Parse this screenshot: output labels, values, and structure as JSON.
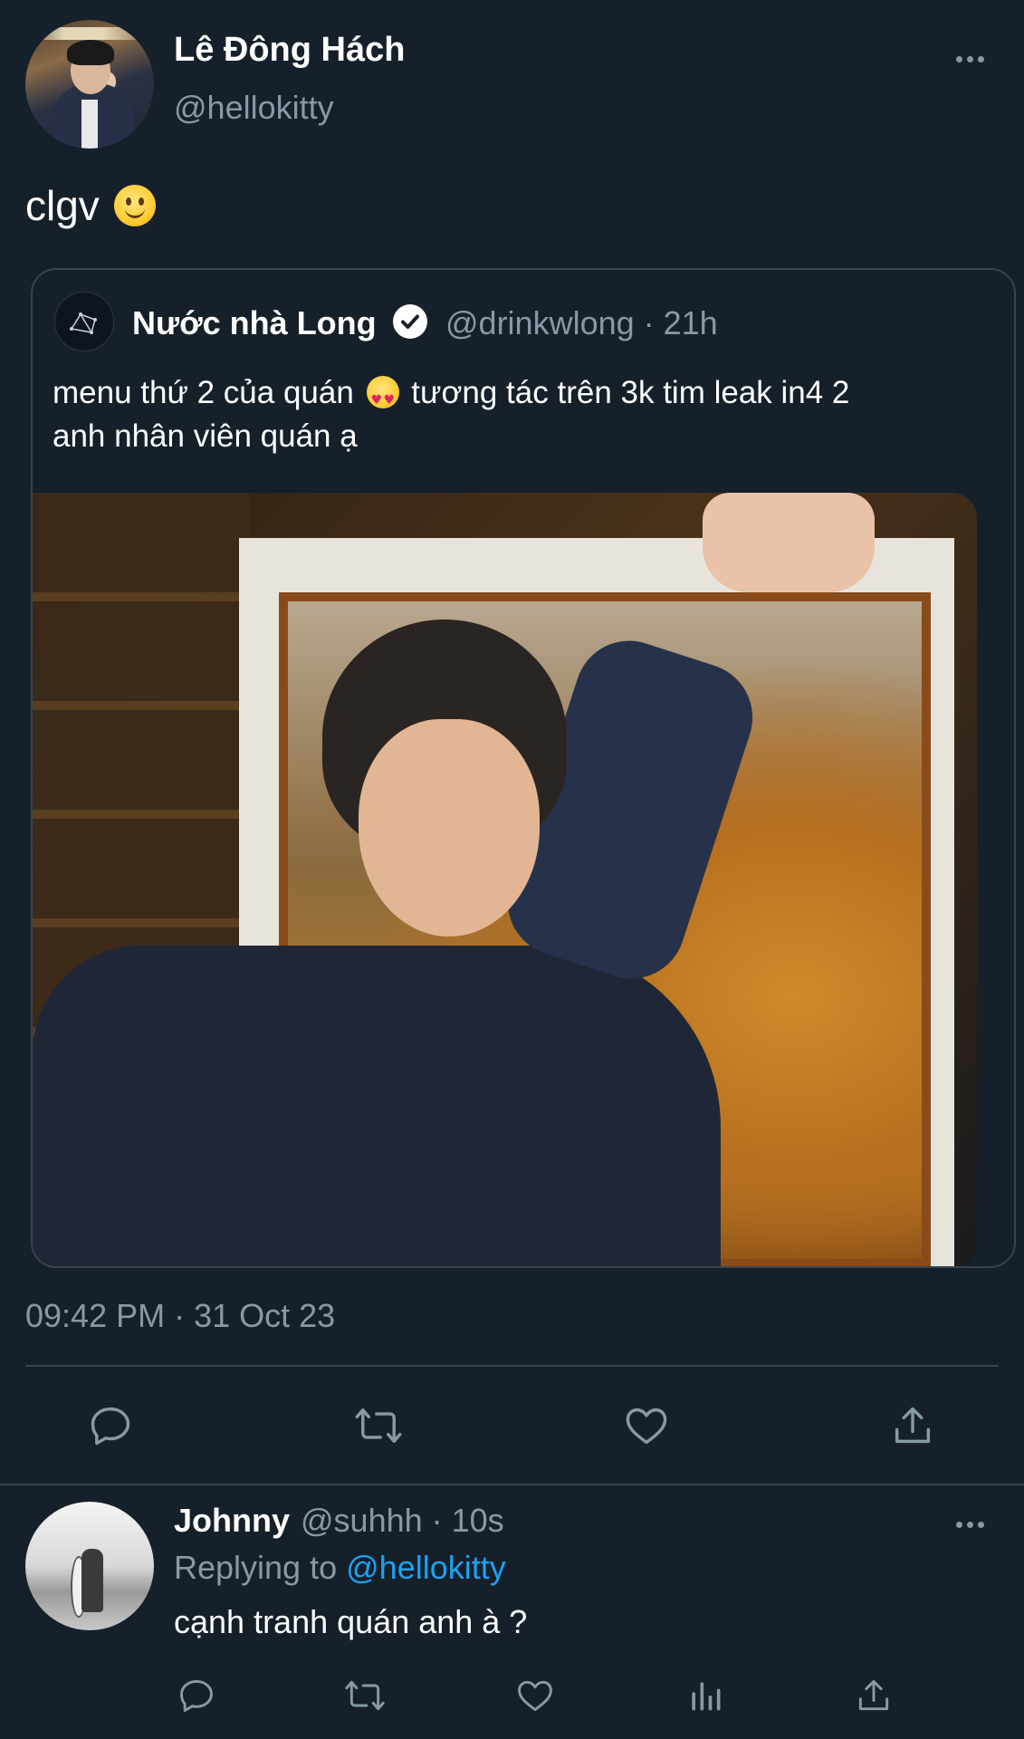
{
  "main_tweet": {
    "display_name": "Lê Đông Hách",
    "handle": "@hellokitty",
    "text": "clgv",
    "emoji": "slightly-smiling-face",
    "timestamp": "09:42 PM · 31 Oct 23"
  },
  "quoted_tweet": {
    "display_name": "Nước nhà Long",
    "verified": true,
    "handle": "@drinkwlong",
    "meta": "@drinkwlong · 21h",
    "text_part1": "menu thứ 2 của quán",
    "emoji": "heart-eyes",
    "text_part2": "tương tác trên 3k tim leak in4 2",
    "text_line2": "anh nhân viên quán ạ"
  },
  "actions": {
    "icons": [
      "reply-icon",
      "retweet-icon",
      "like-icon",
      "share-icon"
    ]
  },
  "reply": {
    "display_name": "Johnny",
    "meta": "@suhhh · 10s",
    "replying_prefix": "Replying to",
    "replying_mention": "@hellokitty",
    "text": "cạnh tranh quán anh à ?",
    "action_icons": [
      "reply-icon",
      "retweet-icon",
      "like-icon",
      "analytics-icon",
      "share-icon"
    ]
  },
  "colors": {
    "background": "#15202b",
    "border": "#38444d",
    "secondary_text": "#8899a6",
    "link": "#1da1f2"
  }
}
